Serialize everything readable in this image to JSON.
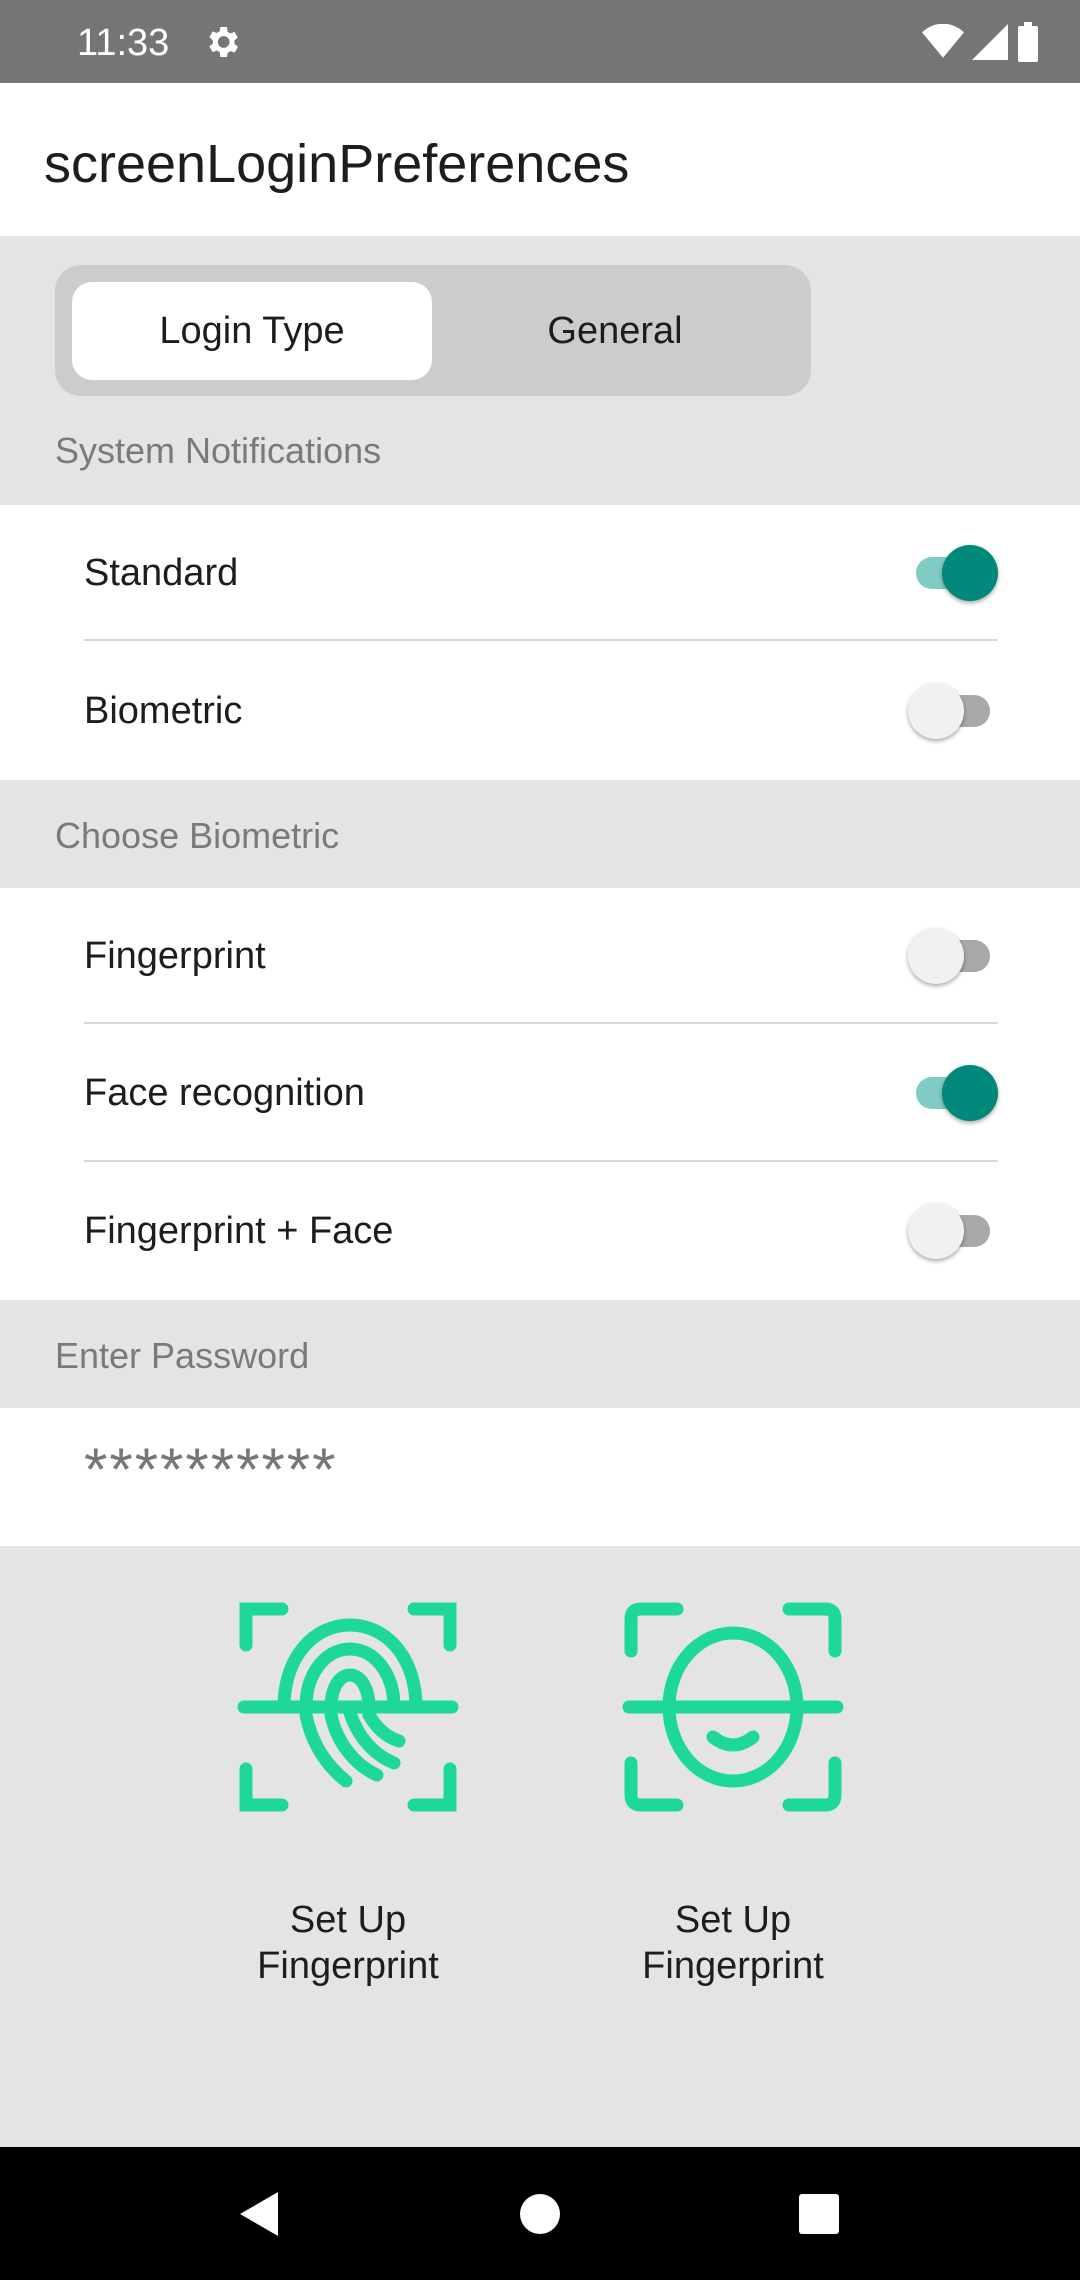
{
  "status_bar": {
    "time": "11:33"
  },
  "app_bar": {
    "title": "screenLoginPreferences"
  },
  "tabs": [
    {
      "label": "Login Type",
      "selected": true
    },
    {
      "label": "General",
      "selected": false
    }
  ],
  "sections": {
    "system_notifications": {
      "header": "System Notifications",
      "items": [
        {
          "label": "Standard",
          "on": true
        },
        {
          "label": "Biometric",
          "on": false
        }
      ]
    },
    "choose_biometric": {
      "header": "Choose Biometric",
      "items": [
        {
          "label": "Fingerprint",
          "on": false
        },
        {
          "label": "Face recognition",
          "on": true
        },
        {
          "label": "Fingerprint + Face",
          "on": false
        }
      ]
    },
    "enter_password": {
      "header": "Enter Password",
      "value": "**********"
    }
  },
  "biometric_actions": [
    {
      "label": "Set Up Fingerprint",
      "icon": "fingerprint-scan-icon"
    },
    {
      "label": "Set Up Fingerprint",
      "icon": "face-scan-icon"
    }
  ],
  "colors": {
    "accent": "#00897b",
    "accent_track": "#80cbc4",
    "icon_green": "#1ed898"
  }
}
